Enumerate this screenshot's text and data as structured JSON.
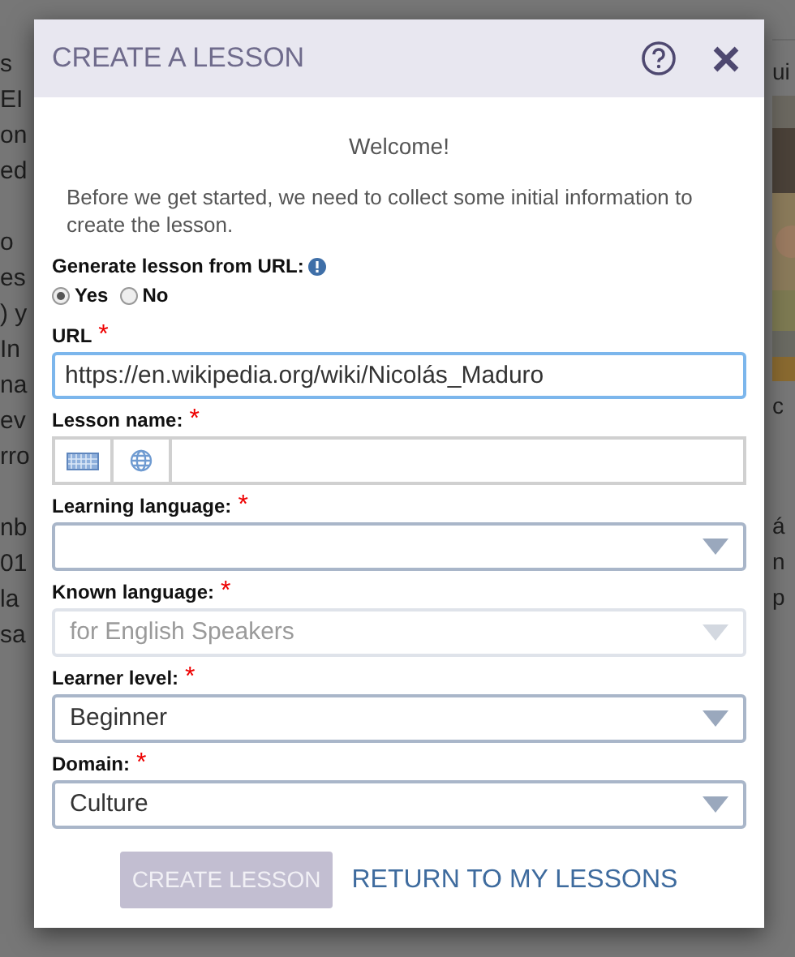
{
  "background": {
    "left_groups": [
      [
        "s",
        "EI",
        "on",
        "ed"
      ],
      [
        "o",
        "es",
        ") y",
        "In",
        "na",
        "ev",
        "rro"
      ],
      [
        "nb",
        "01",
        "la",
        "sa"
      ]
    ],
    "right_top": "ui",
    "right_lines": [
      "c",
      "á",
      "n",
      "p"
    ]
  },
  "dialog": {
    "title": "CREATE A LESSON",
    "welcome": "Welcome!",
    "intro": "Before we get started, we need to collect some initial information to create the lesson.",
    "generate": {
      "label": "Generate lesson from URL:",
      "options": [
        {
          "label": "Yes",
          "selected": true
        },
        {
          "label": "No",
          "selected": false
        }
      ]
    },
    "fields": [
      {
        "kind": "text",
        "label": "URL",
        "marker": "*",
        "value": "https://en.wikipedia.org/wiki/Nicolás_Maduro",
        "focused": true
      },
      {
        "kind": "name",
        "label": "Lesson name:",
        "marker": "*"
      },
      {
        "kind": "select",
        "label": "Learning language:",
        "marker": "*",
        "disabled": false
      },
      {
        "kind": "select",
        "label": "Known language:",
        "marker": "*",
        "value": "for English Speakers",
        "disabled": true
      },
      {
        "kind": "select",
        "label": "Learner level:",
        "marker": "*",
        "value": "Beginner",
        "disabled": false
      },
      {
        "kind": "select",
        "label": "Domain:",
        "marker": "*",
        "value": "Culture",
        "disabled": false
      }
    ],
    "buttons": [
      {
        "label": "CREATE LESSON",
        "disabled": true
      },
      {
        "label": "RETURN TO MY LESSONS",
        "disabled": false
      }
    ]
  }
}
